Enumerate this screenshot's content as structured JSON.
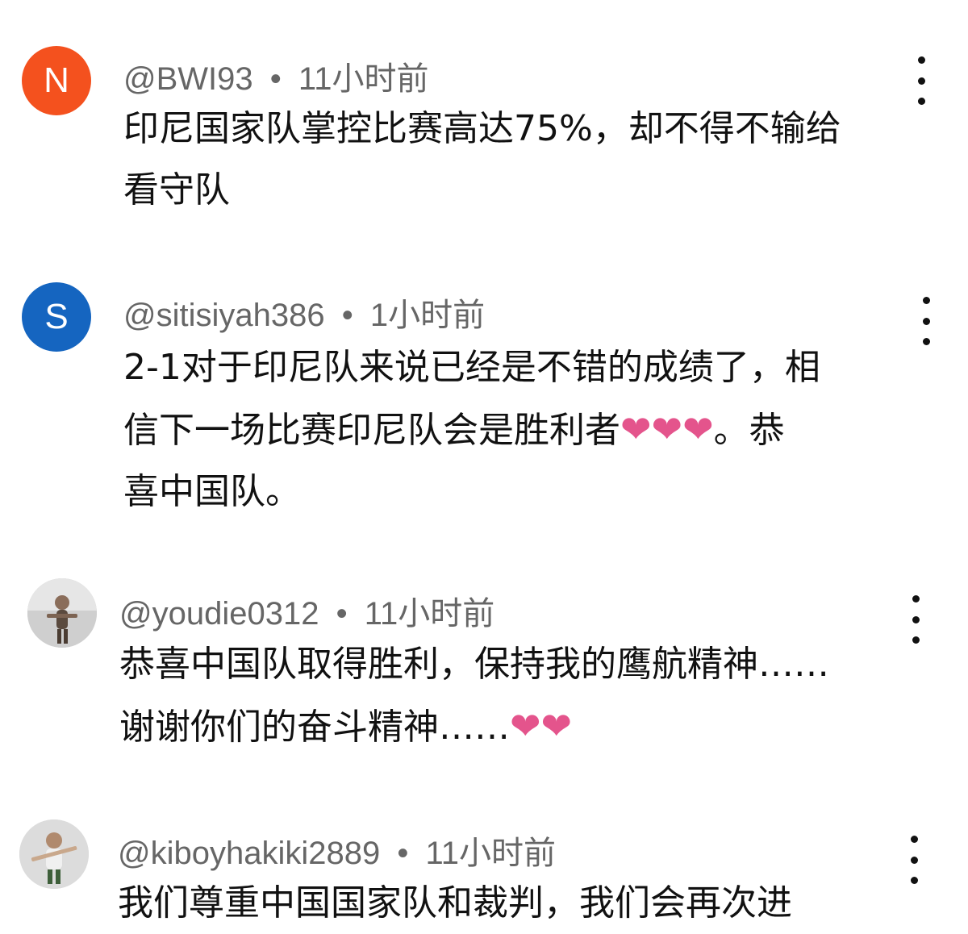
{
  "comments": [
    {
      "avatar_letter": "N",
      "avatar_color": "#f4511e",
      "username": "@BWI93",
      "separator": "•",
      "time": "11小时前",
      "lines": [
        "印尼国家队掌控比赛高达75%，却不得不输给",
        "看守队"
      ]
    },
    {
      "avatar_letter": "S",
      "avatar_color": "#1565c0",
      "username": "@sitisiyah386",
      "separator": "•",
      "time": "1小时前",
      "line1": "2-1对于印尼队来说已经是不错的成绩了，相",
      "line2_text": "信下一场比赛印尼队会是胜利者",
      "line2_suffix": "。恭",
      "line3": "喜中国队。"
    },
    {
      "username": "@youdie0312",
      "separator": "•",
      "time": "11小时前",
      "line1": "恭喜中国队取得胜利，保持我的鹰航精神……",
      "line2_text": "谢谢你们的奋斗精神……"
    },
    {
      "username": "@kiboyhakiki2889",
      "separator": "•",
      "time": "11小时前",
      "line1": "我们尊重中国国家队和裁判，我们会再次进"
    }
  ],
  "icons": {
    "heart": "❤",
    "more": "more-vertical-icon"
  },
  "colors": {
    "heart": "#e4548c",
    "meta_text": "#666666"
  }
}
